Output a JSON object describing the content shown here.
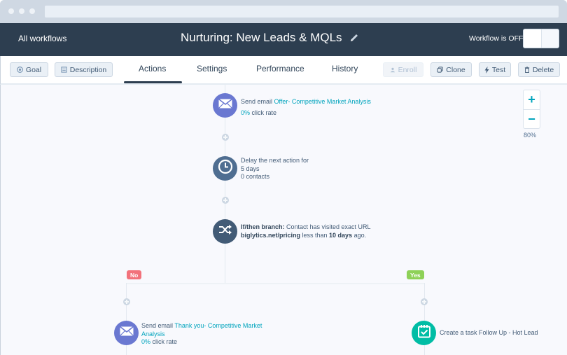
{
  "browser": {
    "dots": [
      "close",
      "minimize",
      "maximize"
    ]
  },
  "header": {
    "back_link": "All workflows",
    "title": "Nurturing: New Leads & MQLs",
    "edit_icon": "pencil-icon",
    "status_label": "Workflow is OFF",
    "toggle_state": "off"
  },
  "toolbar": {
    "left_buttons": [
      {
        "label": "Goal",
        "icon": "target-icon"
      },
      {
        "label": "Description",
        "icon": "document-icon"
      }
    ],
    "tabs": [
      {
        "label": "Actions",
        "active": true
      },
      {
        "label": "Settings",
        "active": false
      },
      {
        "label": "Performance",
        "active": false
      },
      {
        "label": "History",
        "active": false
      }
    ],
    "right_buttons": [
      {
        "label": "Enroll",
        "icon": "person-icon",
        "disabled": true
      },
      {
        "label": "Clone",
        "icon": "copy-icon",
        "disabled": false
      },
      {
        "label": "Test",
        "icon": "lightning-icon",
        "disabled": false
      },
      {
        "label": "Delete",
        "icon": "trash-icon",
        "disabled": false
      }
    ]
  },
  "zoom": {
    "zoom_in": "+",
    "zoom_out": "−",
    "level": "80%"
  },
  "workflow": {
    "nodes": [
      {
        "type": "email",
        "icon": "envelope-icon",
        "prefix": "Send email ",
        "link": "Offer- Competitive Market Analysis",
        "rate_value": "0%",
        "rate_label": " click rate"
      },
      {
        "type": "delay",
        "icon": "clock-icon",
        "line1": "Delay the next action for",
        "line2": "5 days",
        "line3": "0 contacts"
      },
      {
        "type": "branch",
        "icon": "shuffle-icon",
        "label": "If/then branch:",
        "text1": " Contact has visited exact URL",
        "url": "biglytics.net/pricing",
        "text2": " less than ",
        "duration": "10 days",
        "text3": " ago."
      }
    ],
    "branches": {
      "no": {
        "label": "No",
        "node": {
          "type": "email",
          "icon": "envelope-icon",
          "prefix": "Send email ",
          "link_line1": "Thank you- Competitive Market",
          "link_line2": "Analysis",
          "rate_value": "0%",
          "rate_label": " click rate"
        }
      },
      "yes": {
        "label": "Yes",
        "node": {
          "type": "task",
          "icon": "calendar-check-icon",
          "text": "Create a task Follow Up - Hot Lead"
        }
      }
    }
  },
  "colors": {
    "header_bg": "#2d3e50",
    "email_node": "#6a78d1",
    "delay_node": "#4f6e91",
    "branch_node": "#425b76",
    "task_node": "#00bda5",
    "link": "#00a4bd",
    "no_badge": "#f2727b",
    "yes_badge": "#8ed158"
  }
}
